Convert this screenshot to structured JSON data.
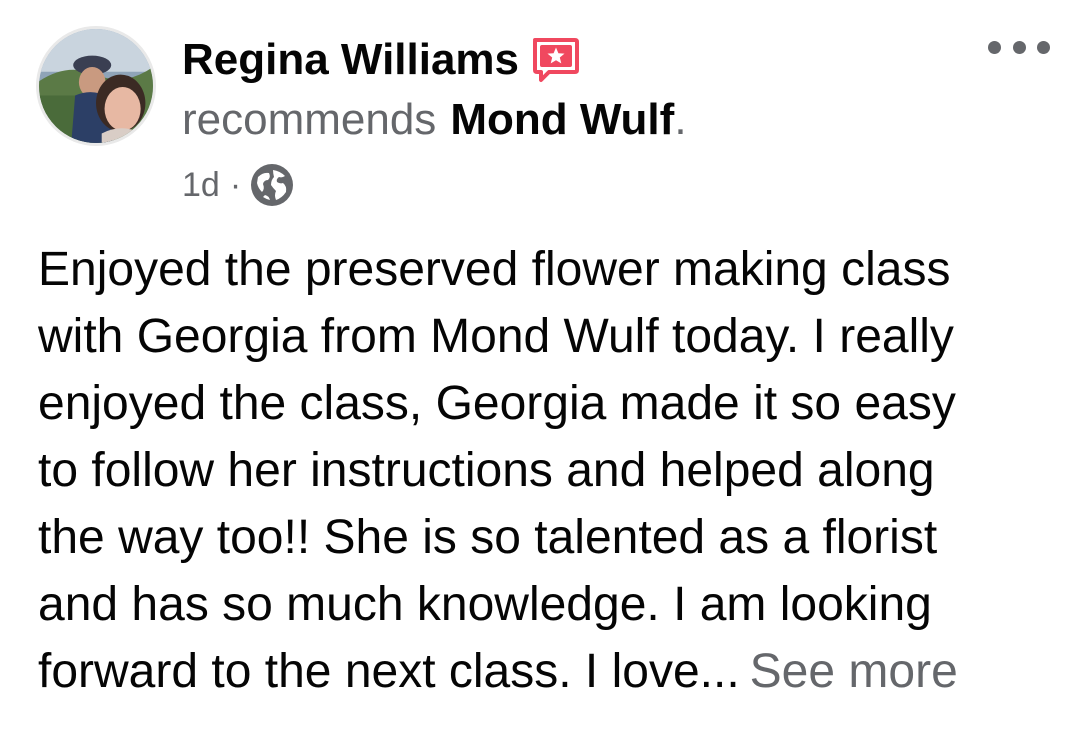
{
  "post": {
    "author": {
      "name": "Regina Williams",
      "avatar": "profile-photo",
      "badge_icon": "recommendation-star-icon",
      "badge_color": "#f0485f"
    },
    "action": {
      "verb": "recommends",
      "page_name": "Mond Wulf",
      "punctuation": "."
    },
    "meta": {
      "time": "1d",
      "separator": "·",
      "privacy_icon": "globe-icon"
    },
    "more_icon": "more-options-icon",
    "body_lines": [
      "Enjoyed the preserved flower making class",
      "with Georgia from Mond Wulf today. I really",
      "enjoyed the class, Georgia made it so easy",
      "to follow her instructions and helped along",
      "the way too!! She is so talented as a florist",
      "and has so much knowledge. I am looking",
      "forward to the next class. I love..."
    ],
    "see_more_label": "See more"
  },
  "colors": {
    "primary_text": "#050505",
    "secondary_text": "#65676b",
    "background": "#ffffff"
  }
}
